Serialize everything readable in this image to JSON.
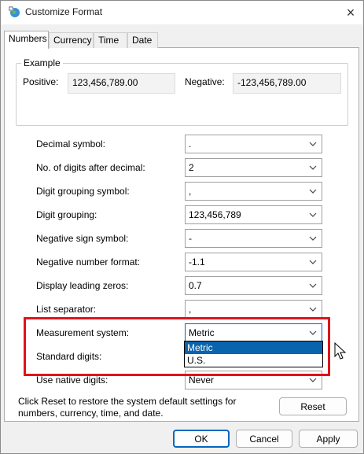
{
  "window": {
    "title": "Customize Format",
    "icon": "region-format-icon",
    "close_symbol": "×"
  },
  "tabs": [
    {
      "label": "Numbers",
      "active": true
    },
    {
      "label": "Currency",
      "active": false
    },
    {
      "label": "Time",
      "active": false
    },
    {
      "label": "Date",
      "active": false
    }
  ],
  "example": {
    "legend": "Example",
    "positive_label": "Positive:",
    "positive_value": "123,456,789.00",
    "negative_label": "Negative:",
    "negative_value": "-123,456,789.00"
  },
  "settings": [
    {
      "label": "Decimal symbol:",
      "value": "."
    },
    {
      "label": "No. of digits after decimal:",
      "value": "2"
    },
    {
      "label": "Digit grouping symbol:",
      "value": ","
    },
    {
      "label": "Digit grouping:",
      "value": "123,456,789"
    },
    {
      "label": "Negative sign symbol:",
      "value": "-"
    },
    {
      "label": "Negative number format:",
      "value": "-1.1"
    },
    {
      "label": "Display leading zeros:",
      "value": "0.7"
    },
    {
      "label": "List separator:",
      "value": ","
    },
    {
      "label": "Measurement system:",
      "value": "Metric"
    },
    {
      "label": "Standard digits:",
      "value": ""
    },
    {
      "label": "Use native digits:",
      "value": "Never"
    }
  ],
  "measurement_dropdown": {
    "options": [
      "Metric",
      "U.S."
    ],
    "highlighted": "Metric"
  },
  "reset_note": "Click Reset to restore the system default settings for numbers, currency, time, and date.",
  "buttons": {
    "reset": "Reset",
    "ok": "OK",
    "cancel": "Cancel",
    "apply": "Apply"
  },
  "colors": {
    "highlight_box": "#e0141b",
    "selection": "#0a64ad",
    "primary_button_border": "#0067c0"
  }
}
